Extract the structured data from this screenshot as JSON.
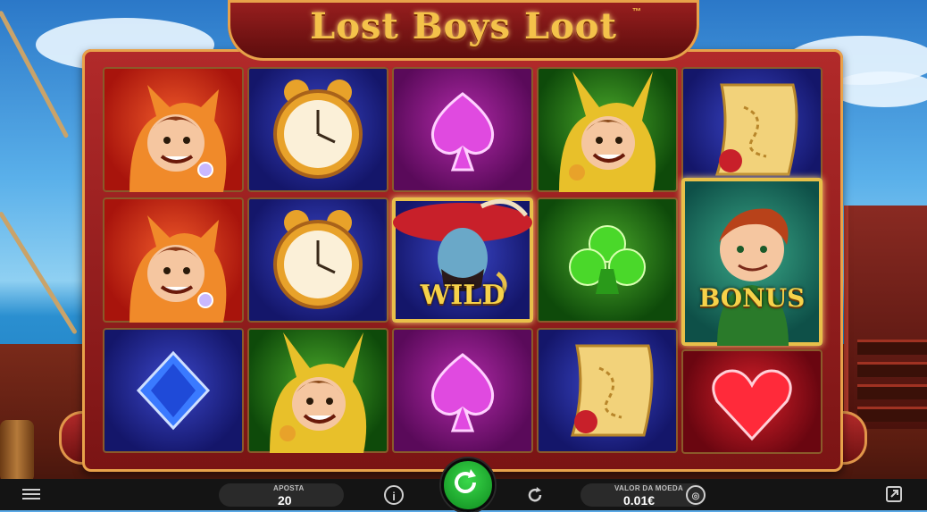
{
  "game": {
    "title": "Lost Boys Loot",
    "trademark": "™"
  },
  "reels": {
    "columns": [
      [
        "lost-boy-fox",
        "lost-boy-fox",
        "blue-diamond"
      ],
      [
        "alarm-clock",
        "alarm-clock",
        "lost-boy-rabbit"
      ],
      [
        "purple-spade",
        "captain-hook-wild",
        "purple-spade"
      ],
      [
        "lost-boy-rabbit",
        "green-club",
        "treasure-map"
      ],
      [
        "treasure-map",
        "peter-pan-bonus",
        "red-heart"
      ]
    ],
    "wild_label": "WILD",
    "bonus_label": "BONUS"
  },
  "bottom_bar": {
    "bet_label": "APOSTA",
    "bet_value": "20",
    "coin_label": "VALOR DA MOEDA",
    "coin_value": "0.01€"
  },
  "colors": {
    "frame": "#9a1f1f",
    "gold": "#f4c24a",
    "spin_button": "#1fb82e",
    "bar": "#141414"
  }
}
